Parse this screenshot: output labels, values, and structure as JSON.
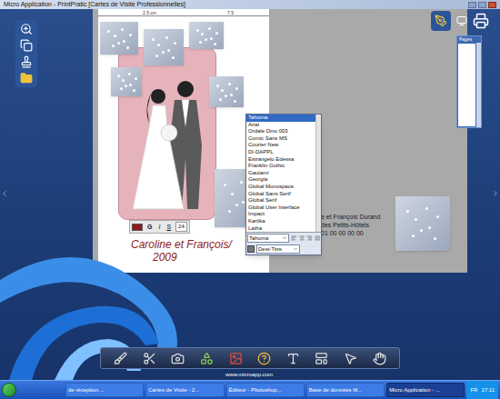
{
  "window": {
    "title": "Micro Application - PrintPratic [Cartes de Visite Professionnelles]"
  },
  "ruler": {
    "marks": [
      "2.5 cm",
      "7.5"
    ]
  },
  "card": {
    "lines": [
      "Caroline et François/",
      "2009"
    ]
  },
  "text_toolbar": {
    "color": "#8e1b1b",
    "bold": "G",
    "italic": "I",
    "underline": "S",
    "size": "24"
  },
  "font_list": {
    "items": [
      {
        "label": "Tahoma",
        "selected": true
      },
      {
        "label": "Arial",
        "selected": false
      },
      {
        "label": "Ordale Dino 003",
        "selected": false
      },
      {
        "label": "Comic Sans MS",
        "selected": false
      },
      {
        "label": "Courier New",
        "selected": false
      },
      {
        "label": "DI-DAPPL",
        "selected": false
      },
      {
        "label": "Estrangelo Edessa",
        "selected": false
      },
      {
        "label": "Franklin Gothic",
        "selected": false
      },
      {
        "label": "Gautami",
        "selected": false
      },
      {
        "label": "Georgia",
        "selected": false
      },
      {
        "label": "Global Monospace",
        "selected": false
      },
      {
        "label": "Global Sans Serif",
        "selected": false
      },
      {
        "label": "Global Serif",
        "selected": false
      },
      {
        "label": "Global User Interface",
        "selected": false
      },
      {
        "label": "Impact",
        "selected": false
      },
      {
        "label": "Kartika",
        "selected": false
      },
      {
        "label": "Latha",
        "selected": false
      }
    ]
  },
  "font_select": {
    "value": "Tahoma"
  },
  "style_select": {
    "value": "Dest-Titre"
  },
  "back_card": {
    "lines": [
      "e et François Durand",
      "des Petits-Hôtels",
      "01 00 00 00 00"
    ]
  },
  "pages_panel": {
    "title": "Pages"
  },
  "footer_url": "www.microapp.com",
  "taskbar": {
    "items": [
      {
        "label": "de réception ...",
        "selected": false
      },
      {
        "label": "Cartes de Visite - 2...",
        "selected": false
      },
      {
        "label": "Éditeur - Photoshop...",
        "selected": false
      },
      {
        "label": "Base de données M...",
        "selected": false
      },
      {
        "label": "Micro Application - ...",
        "selected": true
      }
    ],
    "lang": "FR",
    "clock": "17:11"
  }
}
